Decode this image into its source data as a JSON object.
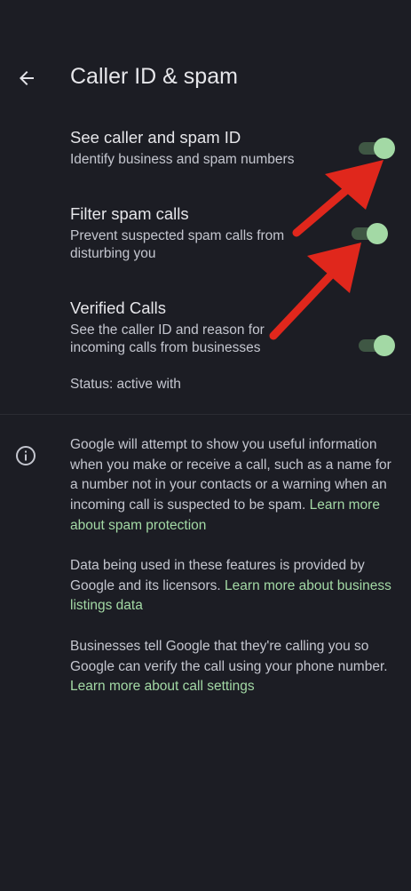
{
  "header": {
    "title": "Caller ID & spam"
  },
  "settings": [
    {
      "title": "See caller and spam ID",
      "description": "Identify business and spam numbers",
      "enabled": true
    },
    {
      "title": "Filter spam calls",
      "description": "Prevent suspected spam calls from disturbing you",
      "enabled": true
    },
    {
      "title": "Verified Calls",
      "description": "See the caller ID and reason for incoming calls from businesses",
      "enabled": true,
      "status": "Status: active with"
    }
  ],
  "info": {
    "p1_text": "Google will attempt to show you useful information when you make or receive a call, such as a name for a number not in your contacts or a warning when an incoming call is suspected to be spam.",
    "p1_link": "Learn more about spam protection",
    "p2_text": "Data being used in these features is provided by Google and its licensors.",
    "p2_link": "Learn more about business listings data",
    "p3_text": "Businesses tell Google that they're calling you so Google can verify the call using your phone number.",
    "p3_link": "Learn more about call settings"
  },
  "colors": {
    "background": "#1c1d24",
    "accent": "#a3d9a5",
    "annotation_arrow": "#e0271c"
  }
}
